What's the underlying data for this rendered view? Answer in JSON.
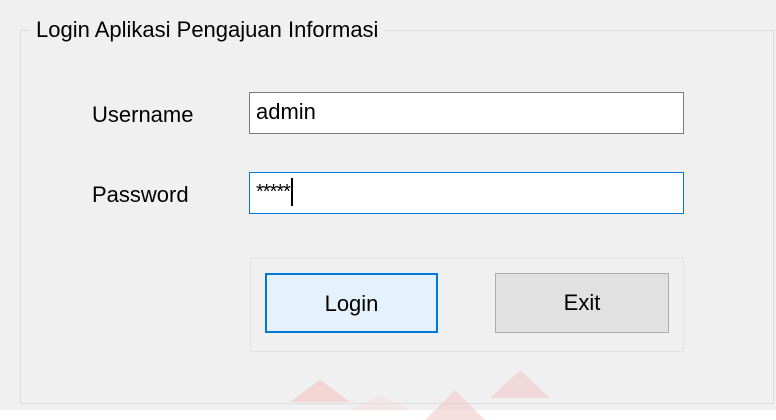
{
  "group": {
    "title": "Login Aplikasi Pengajuan Informasi"
  },
  "form": {
    "username_label": "Username",
    "username_value": "admin",
    "password_label": "Password",
    "password_value": "*****"
  },
  "buttons": {
    "login_label": "Login",
    "exit_label": "Exit"
  },
  "colors": {
    "focus_border": "#0078d7",
    "login_bg": "#e5f1fb",
    "exit_bg": "#e1e1e1",
    "window_bg": "#f0f0f0"
  }
}
